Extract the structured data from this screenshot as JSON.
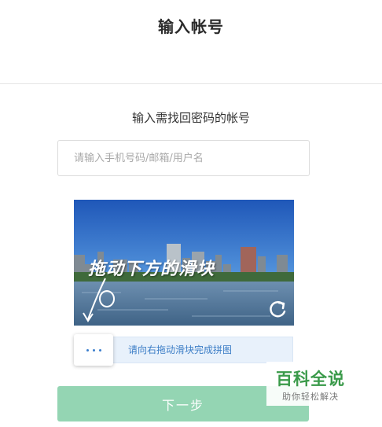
{
  "header": {
    "title": "输入帐号"
  },
  "main": {
    "subtitle": "输入需找回密码的帐号",
    "account_input": {
      "placeholder": "请输入手机号码/邮箱/用户名",
      "value": ""
    }
  },
  "captcha": {
    "image_caption": "拖动下方的滑块",
    "refresh_icon": "refresh-icon",
    "slider_hint": "请向右拖动滑块完成拼图",
    "handle_icon": "dots-icon"
  },
  "actions": {
    "next_label": "下一步"
  },
  "watermark": {
    "title": "百科全说",
    "subtitle": "助你轻松解决"
  },
  "colors": {
    "accent_blue": "#3b7dc6",
    "slider_track": "#e8f1fb",
    "next_button": "#94d5b3",
    "watermark_green": "#3a9a4a"
  }
}
